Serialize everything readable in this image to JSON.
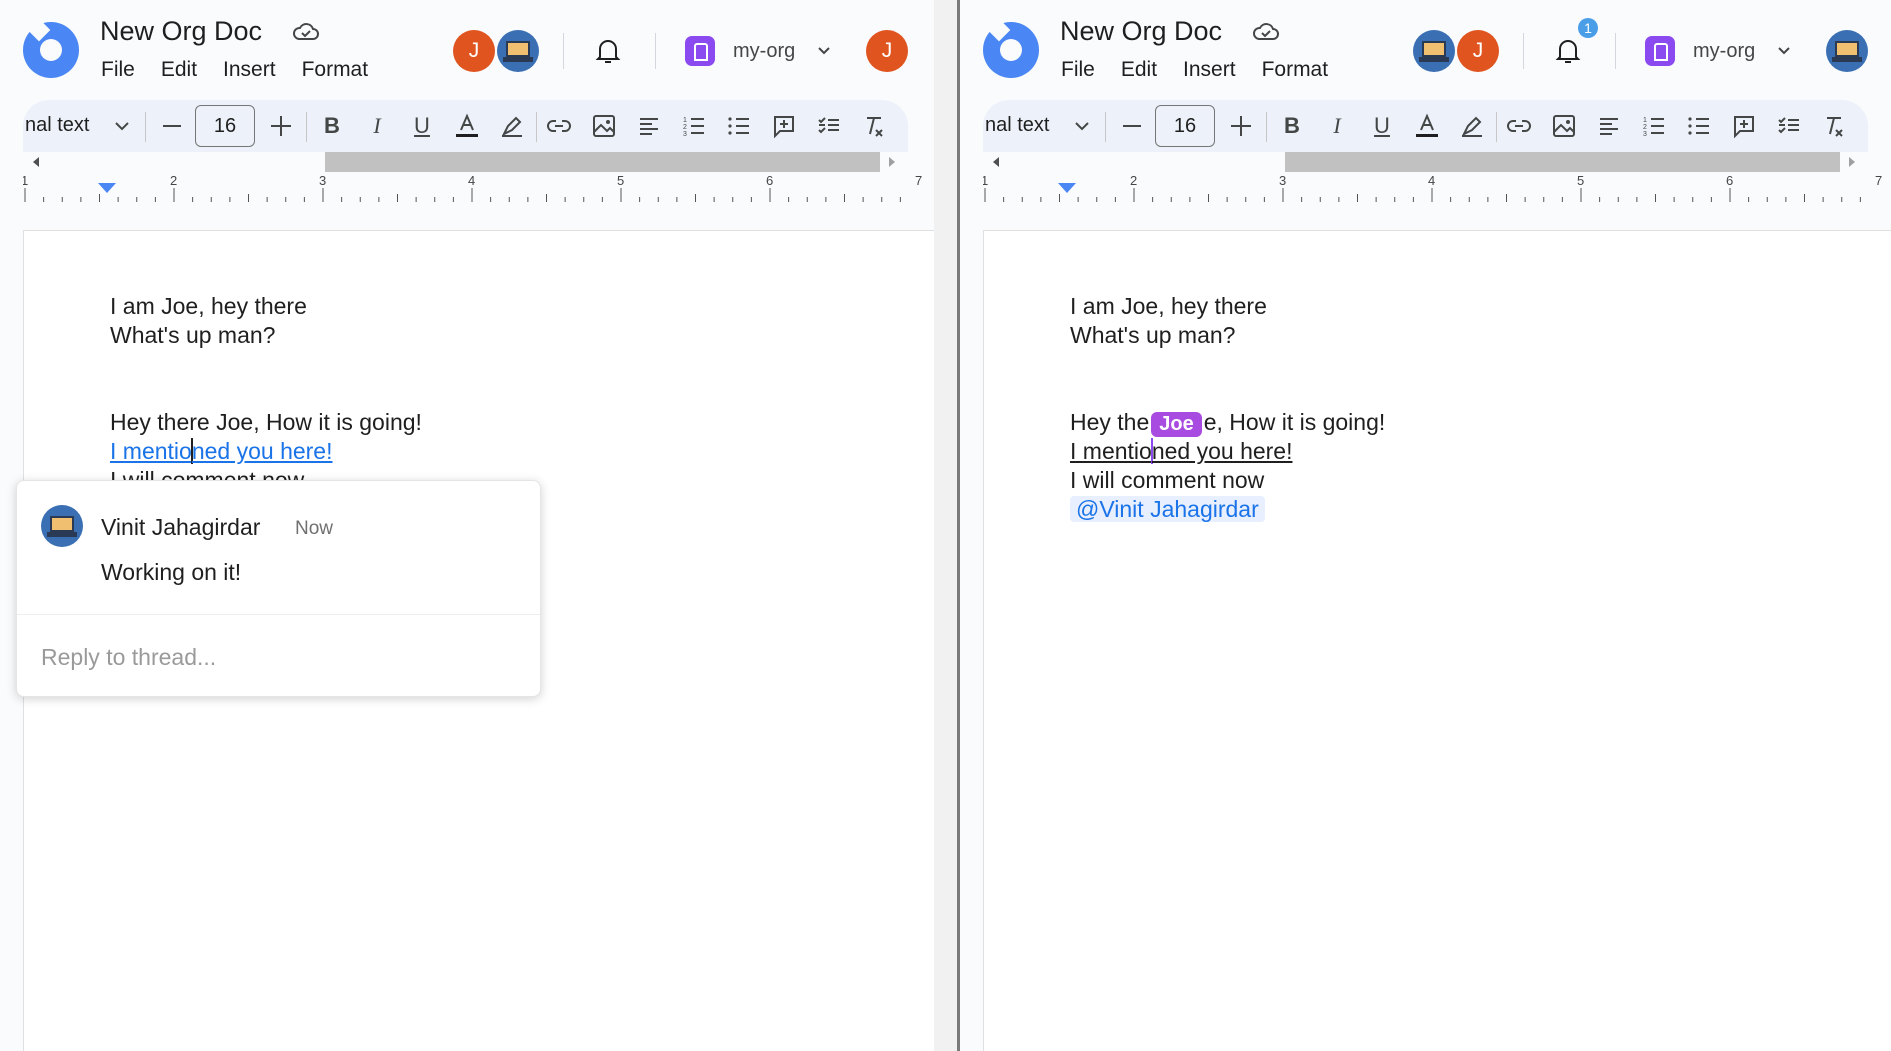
{
  "left": {
    "doc_title": "New Org Doc",
    "menu": [
      "File",
      "Edit",
      "Insert",
      "Format"
    ],
    "avatar_initial": "J",
    "user_initial": "J",
    "org_name": "my-org",
    "toolbar": {
      "style": "nal text",
      "font_size": "16"
    },
    "ruler_labels": [
      "1",
      "2",
      "3",
      "4",
      "5",
      "6",
      "7"
    ],
    "doc": {
      "l1": "I am Joe, hey there",
      "l2": "What's up man?",
      "l3": "Hey there Joe, How it is going!",
      "l4a": "I mentio",
      "l4b": "ned you here!",
      "l5": "I will comment now"
    },
    "comment": {
      "author": "Vinit Jahagirdar",
      "time": "Now",
      "body": "Working on it!",
      "reply_placeholder": "Reply to thread..."
    }
  },
  "right": {
    "doc_title": "New Org Doc",
    "menu": [
      "File",
      "Edit",
      "Insert",
      "Format"
    ],
    "avatar_initial": "J",
    "notification_count": "1",
    "org_name": "my-org",
    "toolbar": {
      "style": "nal text",
      "font_size": "16"
    },
    "ruler_labels": [
      "1",
      "2",
      "3",
      "4",
      "5",
      "6",
      "7"
    ],
    "doc": {
      "l1": "I am Joe, hey there",
      "l2": "What's up man?",
      "l3a": "Hey the",
      "cursor_label": "Joe",
      "l3b": "e, How it is going!",
      "l4a": "I mentio",
      "l4b": "ned you here!",
      "l5": "I will comment now",
      "mention": "@Vinit Jahagirdar"
    }
  },
  "colors": {
    "accent_blue": "#1a73e8",
    "avatar_orange": "#e0541f",
    "org_purple": "#8a4af0",
    "cursor_purple": "#a84be0",
    "badge_blue": "#4a9ee8"
  }
}
